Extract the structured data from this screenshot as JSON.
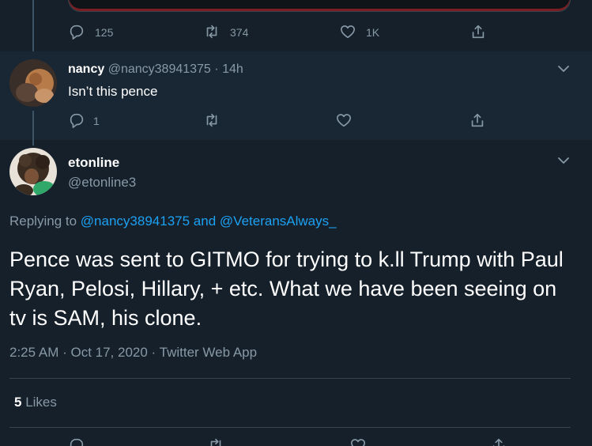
{
  "top_tweet": {
    "reply_count": "125",
    "retweet_count": "374",
    "like_count": "1K"
  },
  "reply_tweet": {
    "display_name": "nancy",
    "handle": "@nancy38941375",
    "separator": "·",
    "time": "14h",
    "text": "Isn’t this pence",
    "reply_count": "1"
  },
  "main_tweet": {
    "display_name": "etonline",
    "handle": "@etonline3",
    "replying_prefix": "Replying to",
    "replying_user1": "@nancy38941375",
    "replying_and": "and",
    "replying_user2": "@VeteransAlways_",
    "text": "Pence was sent to GITMO for trying to k.ll Trump with Paul Ryan, Pelosi, Hillary, + etc. What we have been seeing on tv is SAM, his clone.",
    "timestamp": "2:25 AM · Oct 17, 2020 · Twitter Web App",
    "likes_count": "5",
    "likes_label": "Likes"
  },
  "colors": {
    "background": "#15202b",
    "reply_background": "#192734",
    "muted": "#8899a6",
    "link": "#1da1f2",
    "divider": "#38444d"
  }
}
